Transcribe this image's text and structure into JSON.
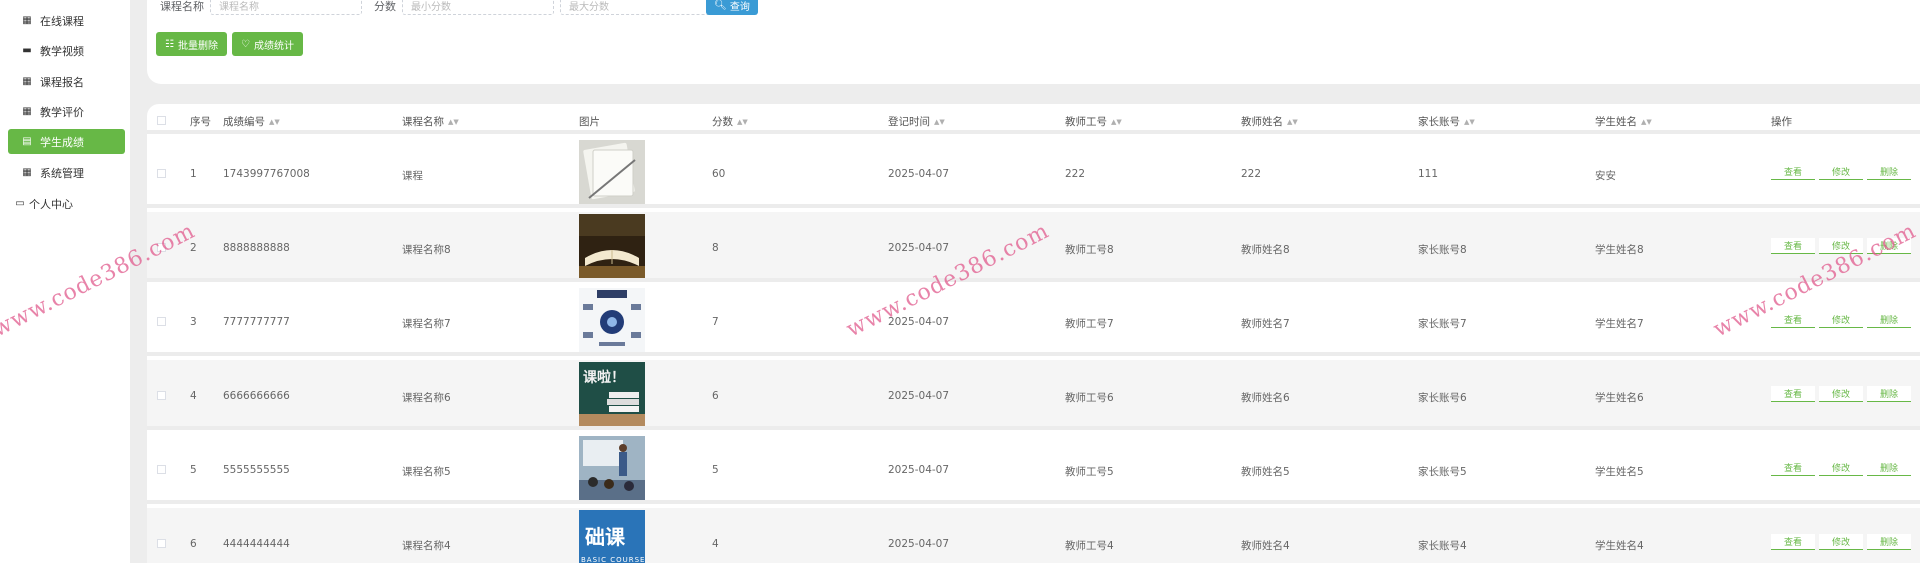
{
  "sidebar": {
    "items": [
      {
        "label": "在线课程",
        "icon": "grid-icon",
        "glyph": "▦",
        "active": false
      },
      {
        "label": "教学视频",
        "icon": "book-icon",
        "glyph": "▬",
        "active": false
      },
      {
        "label": "课程报名",
        "icon": "grid-icon",
        "glyph": "▦",
        "active": false
      },
      {
        "label": "教学评价",
        "icon": "grid-icon",
        "glyph": "▦",
        "active": false
      },
      {
        "label": "学生成绩",
        "icon": "clipboard-icon",
        "glyph": "▤",
        "active": true
      },
      {
        "label": "系统管理",
        "icon": "grid-icon",
        "glyph": "▦",
        "active": false
      },
      {
        "label": "个人中心",
        "icon": "card-icon",
        "glyph": "▭",
        "active": false
      }
    ]
  },
  "search": {
    "course_name_label": "课程名称",
    "course_name_placeholder": "课程名称",
    "score_label": "分数",
    "min_score_placeholder": "最小分数",
    "max_score_placeholder": "最大分数",
    "search_button": "查询"
  },
  "actions": {
    "batch_delete": "批量删除",
    "score_stats": "成绩统计"
  },
  "table": {
    "headers": {
      "index": "序号",
      "score_no": "成绩编号",
      "course_name": "课程名称",
      "image": "图片",
      "score": "分数",
      "reg_time": "登记时间",
      "teacher_no": "教师工号",
      "teacher_name": "教师姓名",
      "parent_account": "家长账号",
      "student_name": "学生姓名",
      "actions": "操作"
    },
    "row_actions": {
      "view": "查看",
      "edit": "修改",
      "delete": "删除"
    },
    "rows": [
      {
        "index": "1",
        "score_no": "1743997767008",
        "course_name": "课程",
        "score": "60",
        "reg_time": "2025-04-07",
        "teacher_no": "222",
        "teacher_name": "222",
        "parent_account": "111",
        "student_name": "安安"
      },
      {
        "index": "2",
        "score_no": "8888888888",
        "course_name": "课程名称8",
        "score": "8",
        "reg_time": "2025-04-07",
        "teacher_no": "教师工号8",
        "teacher_name": "教师姓名8",
        "parent_account": "家长账号8",
        "student_name": "学生姓名8"
      },
      {
        "index": "3",
        "score_no": "7777777777",
        "course_name": "课程名称7",
        "score": "7",
        "reg_time": "2025-04-07",
        "teacher_no": "教师工号7",
        "teacher_name": "教师姓名7",
        "parent_account": "家长账号7",
        "student_name": "学生姓名7"
      },
      {
        "index": "4",
        "score_no": "6666666666",
        "course_name": "课程名称6",
        "score": "6",
        "reg_time": "2025-04-07",
        "teacher_no": "教师工号6",
        "teacher_name": "教师姓名6",
        "parent_account": "家长账号6",
        "student_name": "学生姓名6"
      },
      {
        "index": "5",
        "score_no": "5555555555",
        "course_name": "课程名称5",
        "score": "5",
        "reg_time": "2025-04-07",
        "teacher_no": "教师工号5",
        "teacher_name": "教师姓名5",
        "parent_account": "家长账号5",
        "student_name": "学生姓名5"
      },
      {
        "index": "6",
        "score_no": "4444444444",
        "course_name": "课程名称4",
        "score": "4",
        "reg_time": "2025-04-07",
        "teacher_no": "教师工号4",
        "teacher_name": "教师姓名4",
        "parent_account": "家长账号4",
        "student_name": "学生姓名4"
      }
    ]
  },
  "thumbnails": [
    {
      "text": ""
    },
    {
      "text": ""
    },
    {
      "text": ""
    },
    {
      "text": "课啦！"
    },
    {
      "text": ""
    },
    {
      "text": "础课",
      "subtext": "BASIC COURSE"
    }
  ],
  "watermark": "www.code386.com",
  "colors": {
    "accent": "#67b846",
    "search": "#3a9bd5",
    "watermark": "#e05a8c"
  }
}
